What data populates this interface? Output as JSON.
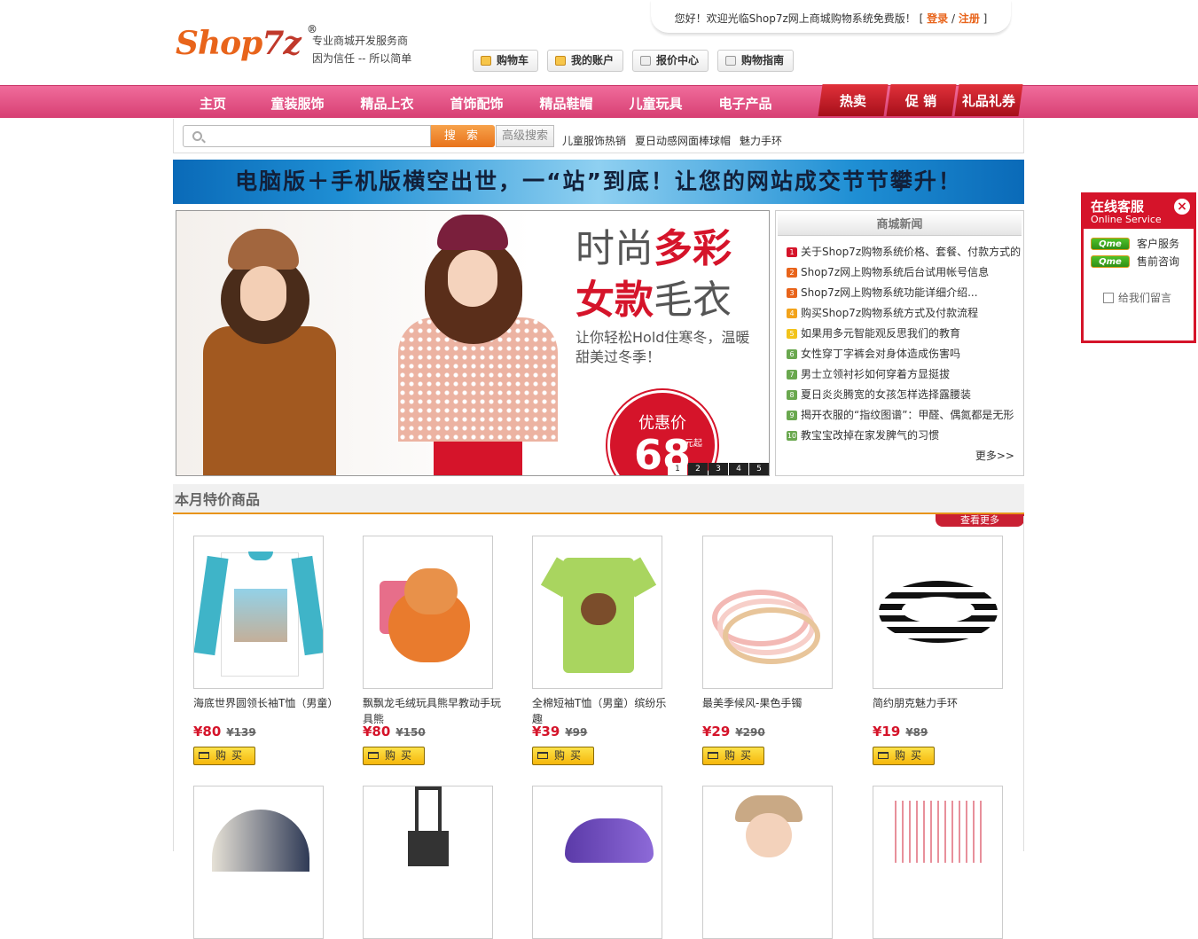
{
  "header": {
    "logo_shop": "Shop",
    "logo_num": "7z",
    "logo_reg": "®",
    "tagline1": "专业商城开发服务商",
    "tagline2": "因为信任 -- 所以简单",
    "welcome_text": "您好！欢迎光临Shop7z网上商城购物系统免费版！",
    "bracket_open": "[",
    "login": "登录",
    "slash": "/",
    "register": "注册",
    "bracket_close": "]",
    "top_buttons": [
      "购物车",
      "我的账户",
      "报价中心",
      "购物指南"
    ]
  },
  "nav": {
    "items": [
      "主页",
      "童装服饰",
      "精品上衣",
      "首饰配饰",
      "精品鞋帽",
      "儿童玩具",
      "电子产品"
    ],
    "hot_tabs": [
      "热卖",
      "促 销",
      "礼品礼券"
    ]
  },
  "search": {
    "placeholder": "",
    "button": "搜 索",
    "advanced": "高级搜索",
    "hot_words": [
      "儿童服饰热销",
      "夏日动感网面棒球帽",
      "魅力手环"
    ]
  },
  "banner_text": "电脑版＋手机版横空出世，一“站”到底！让您的网站成交节节攀升！",
  "slider": {
    "title1_plain": "时尚",
    "title1_bold": "多彩",
    "title2_bold": "女款",
    "title2_plain": "毛衣",
    "subtitle": "让你轻松Hold住寒冬，温暖甜美过冬季！",
    "price_label": "优惠价",
    "price_value": "68",
    "price_unit": "元起",
    "dots": [
      "1",
      "2",
      "3",
      "4",
      "5"
    ],
    "active_dot": 1
  },
  "news": {
    "title": "商城新闻",
    "items": [
      "关于Shop7z购物系统价格、套餐、付款方式的",
      "Shop7z网上购物系统后台试用帐号信息",
      "Shop7z网上购物系统功能详细介绍...",
      "购买Shop7z购物系统方式及付款流程",
      "如果用多元智能观反思我们的教育",
      "女性穿丁字裤会对身体造成伤害吗",
      "男士立领衬衫如何穿着方显挺拔",
      "夏日炎炎腾宽的女孩怎样选择露腰装",
      "揭开衣服的“指纹图谱”：甲醛、偶氮都是无形",
      "教宝宝改掉在家发脾气的习惯"
    ],
    "more": "更多>>"
  },
  "section": {
    "title": "本月特价商品",
    "view_more": "查看更多",
    "buy_label": "购买",
    "currency": "¥",
    "products": [
      {
        "name": "海底世界圆领长袖T恤（男童）",
        "price": "¥80",
        "orig": "¥139"
      },
      {
        "name": "飘飘龙毛绒玩具熊早教动手玩具熊",
        "price": "¥80",
        "orig": "¥150"
      },
      {
        "name": "全棉短袖T恤（男童）缤纷乐趣",
        "price": "¥39",
        "orig": "¥99"
      },
      {
        "name": "最美季候风-果色手镯",
        "price": "¥29",
        "orig": "¥290"
      },
      {
        "name": "简约朋克魅力手环",
        "price": "¥19",
        "orig": "¥89"
      }
    ]
  },
  "service": {
    "title": "在线客服",
    "subtitle": "Online Service",
    "close": "×",
    "qq_badge": "Qme",
    "items": [
      "客户服务",
      "售前咨询"
    ],
    "leave_msg": "给我们留言"
  }
}
